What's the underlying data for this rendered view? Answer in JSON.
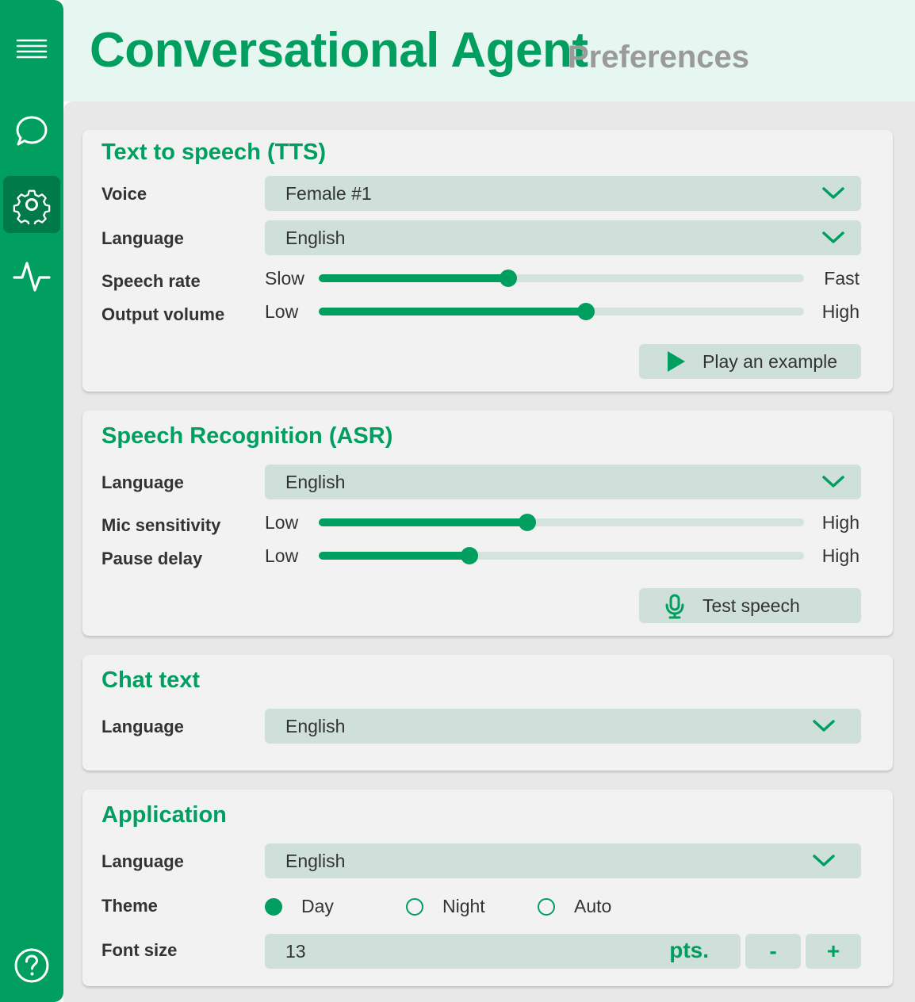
{
  "app": {
    "title": "Conversational Agent",
    "subtitle": "Preferences"
  },
  "sidebar": {
    "items": [
      {
        "name": "menu",
        "icon": "hamburger-menu-icon",
        "active": false
      },
      {
        "name": "chat",
        "icon": "chat-bubble-icon",
        "active": false
      },
      {
        "name": "settings",
        "icon": "gear-icon",
        "active": true
      },
      {
        "name": "activity",
        "icon": "activity-pulse-icon",
        "active": false
      },
      {
        "name": "help",
        "icon": "help-circle-icon",
        "active": false
      }
    ]
  },
  "tts": {
    "title": "Text to speech (TTS)",
    "voice": {
      "label": "Voice",
      "value": "Female #1"
    },
    "language": {
      "label": "Language",
      "value": "English"
    },
    "speech_rate": {
      "label": "Speech rate",
      "min_label": "Slow",
      "max_label": "Fast",
      "level": 0.39
    },
    "output_volume": {
      "label": "Output volume",
      "min_label": "Low",
      "max_label": "High",
      "level": 0.55
    },
    "play_button": {
      "label": "Play an example",
      "icon": "play-icon"
    }
  },
  "asr": {
    "title": "Speech Recognition (ASR)",
    "language": {
      "label": "Language",
      "value": "English"
    },
    "mic_sensitivity": {
      "label": "Mic sensitivity",
      "min_label": "Low",
      "max_label": "High",
      "level": 0.43
    },
    "pause_delay": {
      "label": "Pause delay",
      "min_label": "Low",
      "max_label": "High",
      "level": 0.31
    },
    "test_button": {
      "label": "Test speech",
      "icon": "microphone-icon"
    }
  },
  "chat_text": {
    "title": "Chat text",
    "language": {
      "label": "Language",
      "value": "English"
    }
  },
  "application": {
    "title": "Application",
    "language": {
      "label": "Language",
      "value": "English"
    },
    "theme": {
      "label": "Theme",
      "options": [
        "Day",
        "Night",
        "Auto"
      ],
      "selected": "Day"
    },
    "font_size": {
      "label": "Font size",
      "value": "13",
      "unit": "pts.",
      "decrement": "-",
      "increment": "+"
    }
  },
  "colors": {
    "accent": "#009e5f",
    "accent_dark": "#007a49",
    "control_bg": "#cfe0da",
    "header_bg": "#e6f6f0"
  }
}
